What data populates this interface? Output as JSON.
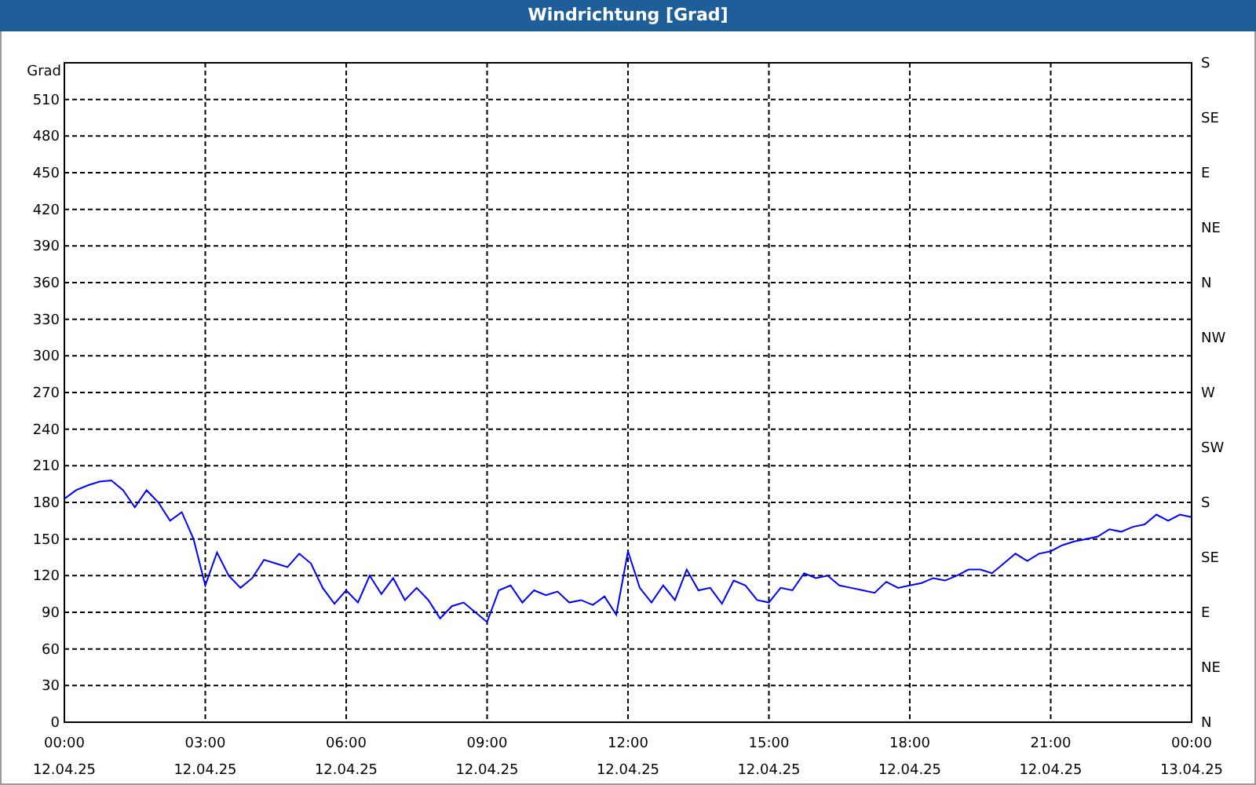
{
  "window": {
    "title": "Windrichtung [Grad]"
  },
  "chart": {
    "chart_data": {
      "type": "line",
      "ylabel": "Grad",
      "ylim": [
        0,
        540
      ],
      "grid": true,
      "categories": [
        "00:00\n12.04.25",
        null,
        null,
        null,
        null,
        null,
        null,
        null,
        null,
        null,
        null,
        null,
        "03:00\n12.04.25",
        null,
        null,
        null,
        null,
        null,
        null,
        null,
        null,
        null,
        null,
        null,
        "06:00\n12.04.25",
        null,
        null,
        null,
        null,
        null,
        null,
        null,
        null,
        null,
        null,
        null,
        "09:00\n12.04.25",
        null,
        null,
        null,
        null,
        null,
        null,
        null,
        null,
        null,
        null,
        null,
        "12:00\n12.04.25",
        null,
        null,
        null,
        null,
        null,
        null,
        null,
        null,
        null,
        null,
        null,
        "15:00\n12.04.25",
        null,
        null,
        null,
        null,
        null,
        null,
        null,
        null,
        null,
        null,
        null,
        "18:00\n12.04.25",
        null,
        null,
        null,
        null,
        null,
        null,
        null,
        null,
        null,
        null,
        null,
        "21:00\n12.04.25",
        null,
        null,
        null,
        null,
        null,
        null,
        null,
        null,
        null,
        null,
        null,
        "00:00\n13.04.25"
      ],
      "series": [
        {
          "color": "#0000ff",
          "values": [
            183,
            190,
            194,
            197,
            198,
            190,
            176,
            190,
            180,
            165,
            172,
            150,
            112,
            139,
            120,
            110,
            118,
            133,
            130,
            127,
            138,
            130,
            110,
            97,
            108,
            98,
            120,
            105,
            118,
            100,
            110,
            100,
            85,
            95,
            98,
            90,
            82,
            108,
            112,
            98,
            108,
            104,
            107,
            98,
            100,
            96,
            103,
            88,
            140,
            110,
            98,
            112,
            100,
            125,
            108,
            110,
            97,
            116,
            112,
            100,
            98,
            110,
            108,
            122,
            118,
            120,
            112,
            110,
            108,
            106,
            115,
            110,
            112,
            114,
            118,
            116,
            120,
            125,
            125,
            122,
            130,
            138,
            132,
            138,
            140,
            145,
            148,
            150,
            152,
            158,
            156,
            160,
            162,
            170,
            165,
            170,
            168
          ]
        }
      ],
      "yticks": [
        0,
        30,
        60,
        90,
        120,
        150,
        180,
        210,
        240,
        270,
        300,
        330,
        360,
        390,
        420,
        450,
        480,
        510
      ]
    },
    "direction_labels": [
      "S",
      "SE",
      "E",
      "NE",
      "N",
      "NW",
      "W",
      "SW",
      "S",
      "SE",
      "E",
      "NE",
      "N"
    ]
  }
}
